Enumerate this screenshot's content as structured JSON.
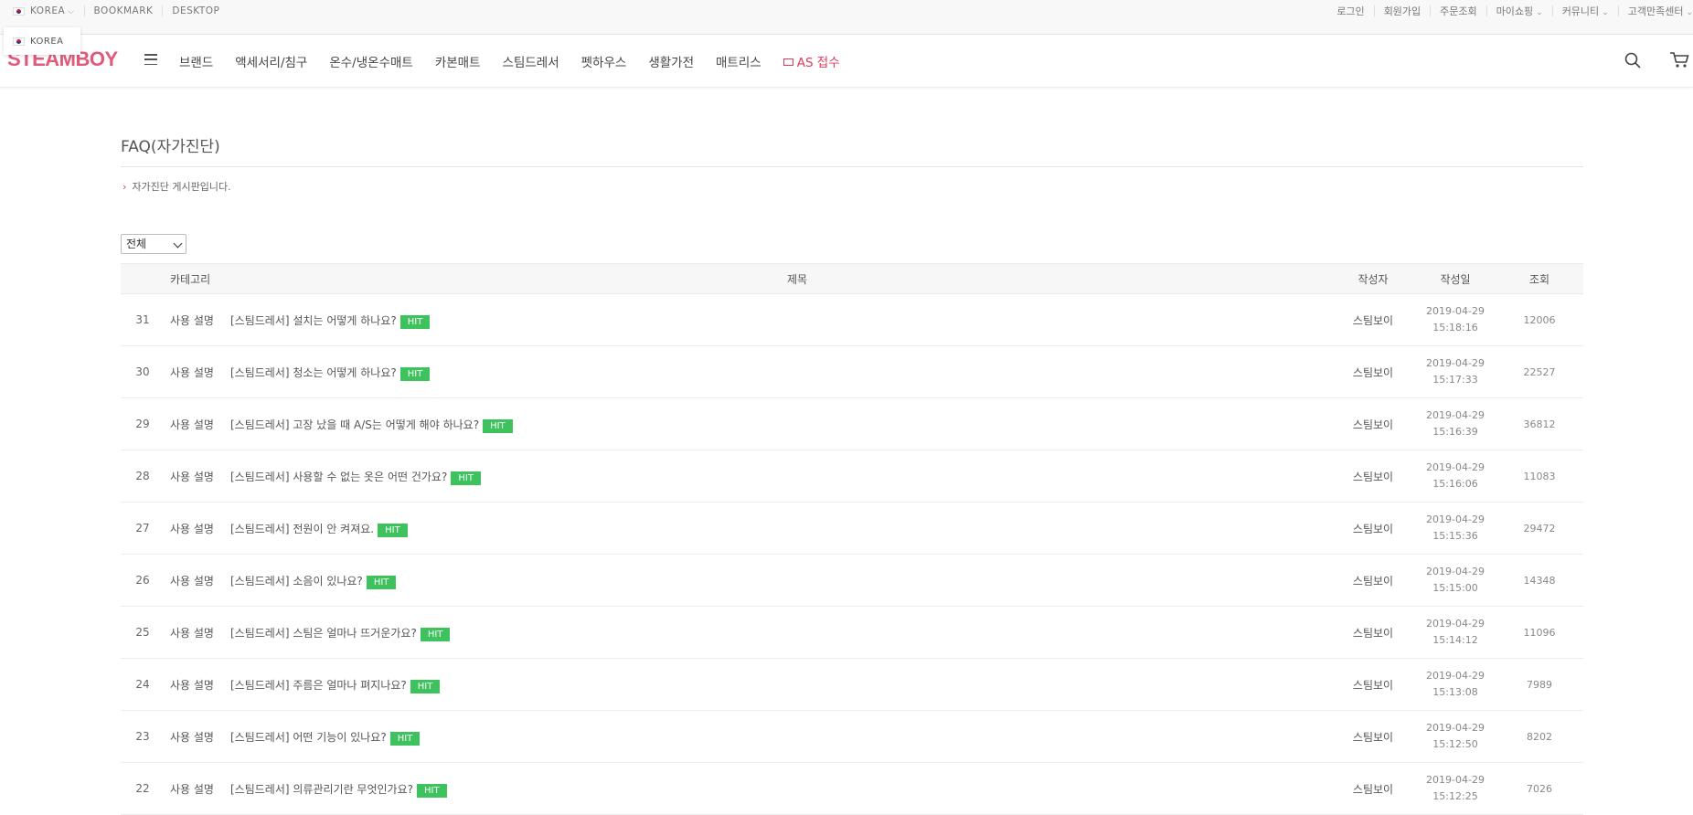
{
  "topbar": {
    "country": "KOREA",
    "bookmark": "BOOKMARK",
    "desktop": "DESKTOP",
    "links": [
      "로그인",
      "회원가입",
      "주문조회",
      "마이쇼핑",
      "커뮤니티",
      "고객만족센터"
    ]
  },
  "lang_popup": {
    "item": "KOREA"
  },
  "nav": {
    "logo": "STEAMBOY",
    "menu": [
      "브랜드",
      "액세서리/침구",
      "온수/냉온수매트",
      "카본매트",
      "스팀드레서",
      "펫하우스",
      "생활가전",
      "매트리스"
    ],
    "as_label": "AS 접수"
  },
  "page": {
    "title": "FAQ(자가진단)",
    "description": "자가진단 게시판입니다.",
    "filter_value": "전체"
  },
  "table": {
    "headers": {
      "category": "카테고리",
      "title": "제목",
      "writer": "작성자",
      "date": "작성일",
      "views": "조회"
    },
    "hit_label": "HIT",
    "rows": [
      {
        "num": "31",
        "category": "사용 설명",
        "title": "[스팀드레서] 설치는 어떻게 하나요?",
        "writer": "스팀보이",
        "date": "2019-04-29",
        "time": "15:18:16",
        "views": "12006"
      },
      {
        "num": "30",
        "category": "사용 설명",
        "title": "[스팀드레서] 청소는 어떻게 하나요?",
        "writer": "스팀보이",
        "date": "2019-04-29",
        "time": "15:17:33",
        "views": "22527"
      },
      {
        "num": "29",
        "category": "사용 설명",
        "title": "[스팀드레서] 고장 났을 때 A/S는 어떻게 해야 하나요?",
        "writer": "스팀보이",
        "date": "2019-04-29",
        "time": "15:16:39",
        "views": "36812"
      },
      {
        "num": "28",
        "category": "사용 설명",
        "title": "[스팀드레서] 사용할 수 없는 옷은 어떤 건가요?",
        "writer": "스팀보이",
        "date": "2019-04-29",
        "time": "15:16:06",
        "views": "11083"
      },
      {
        "num": "27",
        "category": "사용 설명",
        "title": "[스팀드레서] 전원이 안 켜져요.",
        "writer": "스팀보이",
        "date": "2019-04-29",
        "time": "15:15:36",
        "views": "29472"
      },
      {
        "num": "26",
        "category": "사용 설명",
        "title": "[스팀드레서] 소음이 있나요?",
        "writer": "스팀보이",
        "date": "2019-04-29",
        "time": "15:15:00",
        "views": "14348"
      },
      {
        "num": "25",
        "category": "사용 설명",
        "title": "[스팀드레서] 스팀은 얼마나 뜨거운가요?",
        "writer": "스팀보이",
        "date": "2019-04-29",
        "time": "15:14:12",
        "views": "11096"
      },
      {
        "num": "24",
        "category": "사용 설명",
        "title": "[스팀드레서] 주름은 얼마나 펴지나요?",
        "writer": "스팀보이",
        "date": "2019-04-29",
        "time": "15:13:08",
        "views": "7989"
      },
      {
        "num": "23",
        "category": "사용 설명",
        "title": "[스팀드레서] 어떤 기능이 있나요?",
        "writer": "스팀보이",
        "date": "2019-04-29",
        "time": "15:12:50",
        "views": "8202"
      },
      {
        "num": "22",
        "category": "사용 설명",
        "title": "[스팀드레서] 의류관리기란 무엇인가요?",
        "writer": "스팀보이",
        "date": "2019-04-29",
        "time": "15:12:25",
        "views": "7026"
      }
    ]
  },
  "colors": {
    "brand": "#e15a7a",
    "accent": "#e03a5c",
    "hit": "#3ec25e"
  },
  "icons": {
    "search": "search-icon",
    "cart": "cart-icon",
    "menu": "hamburger-icon",
    "mail": "mail-icon"
  }
}
